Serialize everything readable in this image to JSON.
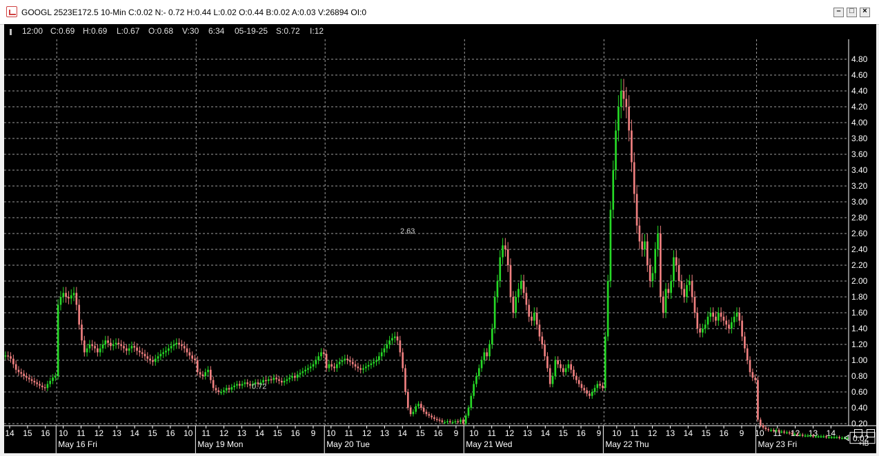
{
  "window": {
    "title": "GOOGL 2523E172.5 10-Min C:0.02 N:- 0.72 H:0.44 L:0.02 O:0.44 B:0.02 A:0.03 V:26894 OI:0",
    "minimize_glyph": "–",
    "maximize_glyph": "□",
    "close_glyph": "×"
  },
  "info_bar": {
    "time": "12:00",
    "close": "C:0.69",
    "high": "H:0.69",
    "low": "L:0.67",
    "open": "O:0.68",
    "volume": "V:30",
    "clock": "6:34",
    "date": "05-19-25",
    "s": "S:0.72",
    "i": "I:12"
  },
  "corner_label": "+IB",
  "colors": {
    "background": "#000000",
    "up": "#26d926",
    "down": "#f08080",
    "grid": "#a0a0a0",
    "text": "#ffffff"
  },
  "chart_data": {
    "type": "candlestick",
    "interval": "10-Min",
    "ylim": [
      0,
      4.9
    ],
    "y_ticks": [
      "4.80",
      "4.60",
      "4.40",
      "4.20",
      "4.00",
      "3.80",
      "3.60",
      "3.40",
      "3.20",
      "3.00",
      "2.80",
      "2.60",
      "2.40",
      "2.20",
      "2.00",
      "1.80",
      "1.60",
      "1.40",
      "1.20",
      "1.00",
      "0.80",
      "0.60",
      "0.40",
      "0.20"
    ],
    "last_price": "0.02",
    "days": [
      {
        "label": "May 16 Fri",
        "ticks": [
          "14",
          "15",
          "16",
          "10",
          "11",
          "12",
          "13",
          "14",
          "15"
        ]
      },
      {
        "label": "May 19 Mon",
        "ticks": [
          "16",
          "10",
          "11",
          "12",
          "13",
          "14",
          "15"
        ]
      },
      {
        "label": "May 20 Tue",
        "ticks": [
          "16",
          "9",
          "10",
          "11",
          "12",
          "13",
          "14",
          "15"
        ]
      },
      {
        "label": "May 21 Wed",
        "ticks": [
          "16",
          "9",
          "10",
          "11",
          "12",
          "13",
          "14",
          "15"
        ]
      },
      {
        "label": "May 22 Thu",
        "ticks": [
          "16",
          "9",
          "10",
          "11",
          "12",
          "13",
          "14",
          "15"
        ]
      },
      {
        "label": "May 23 Fri",
        "ticks": [
          "16",
          "9",
          "10",
          "11",
          "12",
          "13",
          "14"
        ]
      }
    ],
    "annotations": [
      {
        "text": "2.63"
      },
      {
        "text": "0.72"
      }
    ],
    "series": [
      {
        "segment": "May 15 close",
        "close": [
          1.06,
          1.05,
          1.02,
          0.95,
          0.88,
          0.85,
          0.83,
          0.8,
          0.78,
          0.76,
          0.74,
          0.72,
          0.7,
          0.68,
          0.66,
          0.65,
          0.7,
          0.74,
          0.78,
          0.8
        ]
      },
      {
        "segment": "May 16 Fri",
        "close": [
          1.7,
          1.8,
          1.85,
          1.8,
          1.78,
          1.82,
          1.85,
          1.7,
          1.45,
          1.25,
          1.1,
          1.15,
          1.2,
          1.18,
          1.15,
          1.1,
          1.15,
          1.2,
          1.25,
          1.22,
          1.18,
          1.2,
          1.22,
          1.2,
          1.18,
          1.15,
          1.12,
          1.15,
          1.18,
          1.16,
          1.12,
          1.1,
          1.08,
          1.05,
          1.02,
          1.0,
          0.98,
          1.02,
          1.05,
          1.08,
          1.1,
          1.12,
          1.15,
          1.18,
          1.2,
          1.22,
          1.2,
          1.18,
          1.15,
          1.1,
          1.06,
          1.02,
          1.0
        ]
      },
      {
        "segment": "May 19 Mon",
        "close": [
          0.85,
          0.82,
          0.8,
          0.85,
          0.88,
          0.75,
          0.65,
          0.62,
          0.6,
          0.6,
          0.62,
          0.65,
          0.63,
          0.66,
          0.68,
          0.7,
          0.68,
          0.7,
          0.72,
          0.7,
          0.68,
          0.7,
          0.72,
          0.7,
          0.72,
          0.75,
          0.74,
          0.76,
          0.75,
          0.78,
          0.76,
          0.74,
          0.72,
          0.74,
          0.76,
          0.78,
          0.8,
          0.78,
          0.82,
          0.84,
          0.86,
          0.88,
          0.9,
          0.92,
          0.95,
          1.0,
          1.05,
          1.1,
          1.08
        ]
      },
      {
        "segment": "May 20 Tue",
        "close": [
          0.9,
          0.95,
          0.92,
          0.9,
          0.95,
          0.98,
          1.0,
          1.02,
          1.0,
          0.98,
          0.95,
          0.92,
          0.9,
          0.88,
          0.9,
          0.92,
          0.94,
          0.96,
          0.98,
          1.0,
          1.05,
          1.1,
          1.15,
          1.2,
          1.25,
          1.28,
          1.3,
          1.25,
          1.1,
          0.9,
          0.6,
          0.4,
          0.32,
          0.35,
          0.42,
          0.45,
          0.4,
          0.35,
          0.32,
          0.3,
          0.28,
          0.26,
          0.25,
          0.24,
          0.22,
          0.22,
          0.23,
          0.22,
          0.22,
          0.23,
          0.22,
          0.25,
          0.2
        ]
      },
      {
        "segment": "May 21 Wed",
        "close": [
          0.3,
          0.4,
          0.55,
          0.7,
          0.8,
          0.9,
          1.0,
          1.1,
          1.05,
          1.2,
          1.4,
          1.8,
          2.0,
          2.3,
          2.45,
          2.4,
          2.2,
          1.8,
          1.6,
          1.8,
          1.9,
          2.0,
          1.85,
          1.7,
          1.55,
          1.5,
          1.6,
          1.45,
          1.3,
          1.2,
          1.05,
          0.9,
          0.7,
          0.8,
          1.0,
          0.95,
          0.9,
          0.85,
          0.9,
          0.95,
          0.88,
          0.8,
          0.75,
          0.7,
          0.65,
          0.62,
          0.58,
          0.55,
          0.6,
          0.65,
          0.7,
          0.68,
          0.65
        ]
      },
      {
        "segment": "May 22 Thu",
        "close": [
          1.3,
          2.0,
          2.9,
          3.4,
          3.9,
          4.2,
          4.4,
          4.3,
          4.2,
          3.9,
          3.5,
          3.1,
          2.7,
          2.5,
          2.4,
          2.5,
          2.2,
          2.0,
          2.1,
          2.4,
          2.6,
          1.8,
          1.6,
          1.9,
          1.85,
          2.0,
          2.3,
          2.2,
          2.0,
          1.9,
          1.8,
          1.95,
          2.0,
          1.8,
          1.6,
          1.4,
          1.35,
          1.4,
          1.45,
          1.55,
          1.6,
          1.55,
          1.5,
          1.6,
          1.55,
          1.5,
          1.45,
          1.4,
          1.48,
          1.55,
          1.6,
          1.5,
          1.3,
          1.15,
          1.0,
          0.85,
          0.78,
          0.75
        ]
      },
      {
        "segment": "May 23 Fri",
        "close": [
          0.25,
          0.18,
          0.15,
          0.13,
          0.12,
          0.12,
          0.11,
          0.12,
          0.1,
          0.1,
          0.09,
          0.09,
          0.08,
          0.07,
          0.07,
          0.06,
          0.06,
          0.05,
          0.05,
          0.05,
          0.05,
          0.04,
          0.04,
          0.04,
          0.04,
          0.04,
          0.03,
          0.03,
          0.03,
          0.03,
          0.03,
          0.02,
          0.02,
          0.02,
          0.02
        ]
      }
    ]
  }
}
